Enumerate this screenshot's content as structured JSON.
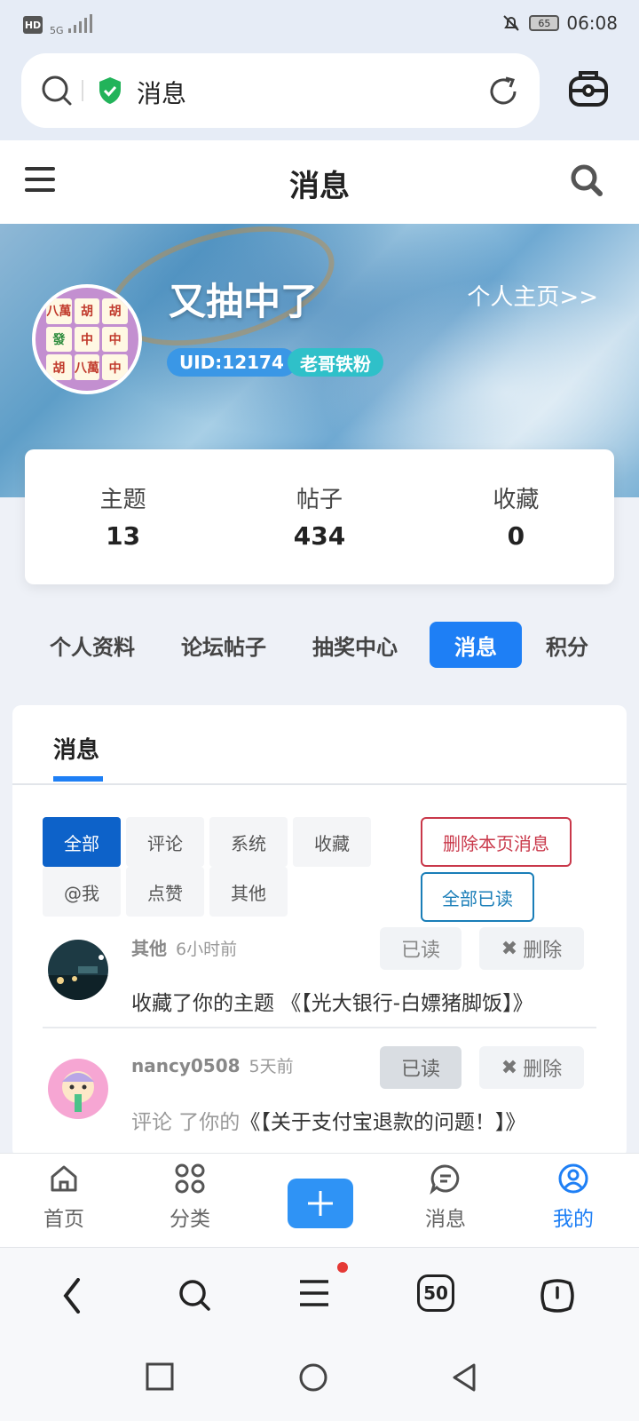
{
  "status_bar": {
    "hd": "HD",
    "network": "5G",
    "battery": "65",
    "time": "06:08"
  },
  "browser": {
    "url_title": "消息"
  },
  "site_header": {
    "title": "消息"
  },
  "profile": {
    "username": "又抽中了",
    "home_link": "个人主页>>",
    "uid_badge": "UID:12174",
    "fan_badge": "老哥铁粉",
    "avatar_tiles": [
      "八萬",
      "胡",
      "胡",
      "發",
      "中",
      "中",
      "胡",
      "八萬",
      "中"
    ]
  },
  "stats": [
    {
      "label": "主题",
      "value": "13"
    },
    {
      "label": "帖子",
      "value": "434"
    },
    {
      "label": "收藏",
      "value": "0"
    }
  ],
  "profile_tabs": [
    "个人资料",
    "论坛帖子",
    "抽奖中心",
    "消息",
    "积分"
  ],
  "panel": {
    "tab": "消息",
    "filters": [
      "全部",
      "评论",
      "系统",
      "收藏",
      "@我",
      "点赞",
      "其他"
    ],
    "delete_page": "删除本页消息",
    "read_all": "全部已读"
  },
  "messages": [
    {
      "name": "其他",
      "time": "6小时前",
      "text_grey": "",
      "text": "收藏了你的主题 《【光大银行-白嫖猪脚饭】》",
      "read_label": "已读",
      "delete_label": "删除"
    },
    {
      "name": "nancy0508",
      "time": "5天前",
      "text_grey": "评论 了你的",
      "text": "《【关于支付宝退款的问题！】》",
      "read_label": "已读",
      "delete_label": "删除"
    }
  ],
  "app_nav": [
    {
      "label": "首页",
      "icon": "home-icon"
    },
    {
      "label": "分类",
      "icon": "grid-icon"
    },
    {
      "label": "消息",
      "icon": "chat-icon"
    },
    {
      "label": "我的",
      "icon": "user-icon"
    }
  ],
  "browser_nav": {
    "tabs_count": "50"
  },
  "colors": {
    "accent": "#1e7ff5",
    "danger": "#c9384a",
    "filter_active": "#0d62c9"
  }
}
